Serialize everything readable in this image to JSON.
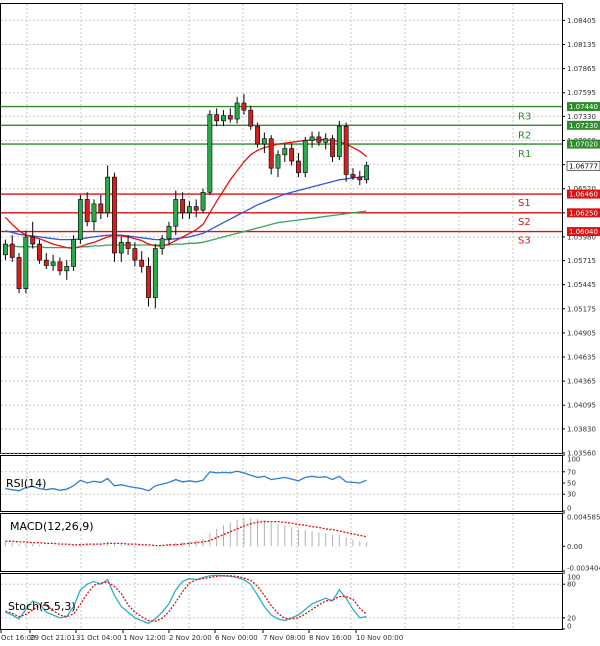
{
  "chart_data": [
    {
      "type": "candlestick",
      "panel": "main",
      "title": "",
      "ylim": [
        1.0356,
        1.086
      ],
      "y_ticks": [
        "1.08405",
        "1.08135",
        "1.07865",
        "1.07595",
        "1.07330",
        "1.07060",
        "1.06790",
        "1.06520",
        "1.06250",
        "1.05980",
        "1.05715",
        "1.05445",
        "1.05175",
        "1.04905",
        "1.04635",
        "1.04365",
        "1.04095",
        "1.03830",
        "1.03560"
      ],
      "x_ticks": [
        "Oct 16:00",
        "29 Oct 21:01",
        "31 Oct 04:00",
        "1 Nov 12:00",
        "2 Nov 20:00",
        "6 Nov 00:00",
        "7 Nov 08:00",
        "8 Nov 16:00",
        "10 Nov 00:00"
      ],
      "current_price": {
        "label": "1.06777",
        "value": 1.06777
      },
      "levels": [
        {
          "name": "R3",
          "value": 1.0744,
          "label": "1.07440",
          "color": "#2e8b2e"
        },
        {
          "name": "R2",
          "value": 1.0723,
          "label": "1.07230",
          "color": "#2e8b2e"
        },
        {
          "name": "R1",
          "value": 1.0702,
          "label": "1.07020",
          "color": "#2e8b2e"
        },
        {
          "name": "S1",
          "value": 1.0646,
          "label": "1.06460",
          "color": "#dd1111"
        },
        {
          "name": "S2",
          "value": 1.0625,
          "label": "1.06250",
          "color": "#dd1111"
        },
        {
          "name": "S3",
          "value": 1.0604,
          "label": "1.06040",
          "color": "#dd1111"
        }
      ],
      "candles": [
        [
          1.0578,
          1.0595,
          1.0572,
          1.059
        ],
        [
          1.059,
          1.06,
          1.057,
          1.0575
        ],
        [
          1.0575,
          1.058,
          1.0535,
          1.054
        ],
        [
          1.054,
          1.0605,
          1.0535,
          1.0598
        ],
        [
          1.0598,
          1.0615,
          1.0585,
          1.059
        ],
        [
          1.059,
          1.0595,
          1.0568,
          1.0572
        ],
        [
          1.0572,
          1.058,
          1.0562,
          1.0566
        ],
        [
          1.0566,
          1.0578,
          1.056,
          1.057
        ],
        [
          1.057,
          1.0575,
          1.0555,
          1.056
        ],
        [
          1.056,
          1.0572,
          1.055,
          1.0565
        ],
        [
          1.0565,
          1.06,
          1.056,
          1.0595
        ],
        [
          1.0595,
          1.0645,
          1.059,
          1.064
        ],
        [
          1.064,
          1.0648,
          1.061,
          1.0615
        ],
        [
          1.0615,
          1.064,
          1.0605,
          1.0635
        ],
        [
          1.0635,
          1.0645,
          1.0618,
          1.0625
        ],
        [
          1.0625,
          1.0678,
          1.062,
          1.0665
        ],
        [
          1.0665,
          1.067,
          1.057,
          1.058
        ],
        [
          1.058,
          1.0598,
          1.057,
          1.0592
        ],
        [
          1.0592,
          1.06,
          1.0578,
          1.0585
        ],
        [
          1.0585,
          1.0592,
          1.0565,
          1.0572
        ],
        [
          1.0572,
          1.0582,
          1.0558,
          1.0565
        ],
        [
          1.0565,
          1.0575,
          1.052,
          1.053
        ],
        [
          1.053,
          1.059,
          1.0518,
          1.0585
        ],
        [
          1.0585,
          1.06,
          1.0578,
          1.0596
        ],
        [
          1.0596,
          1.0615,
          1.059,
          1.061
        ],
        [
          1.061,
          1.065,
          1.06,
          1.064
        ],
        [
          1.064,
          1.0648,
          1.0618,
          1.0625
        ],
        [
          1.0625,
          1.0638,
          1.0618,
          1.0632
        ],
        [
          1.0632,
          1.064,
          1.062,
          1.0628
        ],
        [
          1.0628,
          1.0652,
          1.0625,
          1.0648
        ],
        [
          1.0648,
          1.074,
          1.0645,
          1.0735
        ],
        [
          1.0735,
          1.0742,
          1.0722,
          1.0728
        ],
        [
          1.0728,
          1.074,
          1.0722,
          1.0734
        ],
        [
          1.0734,
          1.0742,
          1.0726,
          1.073
        ],
        [
          1.073,
          1.0755,
          1.0725,
          1.0748
        ],
        [
          1.0748,
          1.0758,
          1.0735,
          1.074
        ],
        [
          1.074,
          1.0745,
          1.0718,
          1.0722
        ],
        [
          1.0722,
          1.0726,
          1.0698,
          1.0702
        ],
        [
          1.0702,
          1.0715,
          1.0692,
          1.0708
        ],
        [
          1.0708,
          1.0712,
          1.0668,
          1.0675
        ],
        [
          1.0675,
          1.0695,
          1.0665,
          1.069
        ],
        [
          1.069,
          1.0702,
          1.0682,
          1.0697
        ],
        [
          1.0697,
          1.0703,
          1.0678,
          1.0683
        ],
        [
          1.0683,
          1.0692,
          1.0665,
          1.067
        ],
        [
          1.067,
          1.071,
          1.0665,
          1.0706
        ],
        [
          1.0706,
          1.0716,
          1.0698,
          1.071
        ],
        [
          1.071,
          1.0716,
          1.07,
          1.0704
        ],
        [
          1.0704,
          1.0714,
          1.0696,
          1.0708
        ],
        [
          1.0708,
          1.0712,
          1.0682,
          1.0688
        ],
        [
          1.0688,
          1.0728,
          1.0684,
          1.0722
        ],
        [
          1.0722,
          1.0726,
          1.066,
          1.0668
        ],
        [
          1.0668,
          1.0675,
          1.0662,
          1.0665
        ],
        [
          1.0665,
          1.0672,
          1.0656,
          1.0662
        ],
        [
          1.0662,
          1.0682,
          1.0658,
          1.0678
        ]
      ],
      "ma_red": [
        1.062,
        1.0612,
        1.0605,
        1.06,
        1.0598,
        1.0596,
        1.0593,
        1.059,
        1.0588,
        1.0586,
        1.0585,
        1.0587,
        1.059,
        1.0592,
        1.0595,
        1.0598,
        1.06,
        1.0599,
        1.0598,
        1.0596,
        1.0594,
        1.059,
        1.0588,
        1.0588,
        1.059,
        1.0594,
        1.0598,
        1.0602,
        1.0606,
        1.0612,
        1.0625,
        1.0638,
        1.065,
        1.0662,
        1.0672,
        1.0682,
        1.069,
        1.0695,
        1.0698,
        1.07,
        1.0702,
        1.0703,
        1.0704,
        1.0705,
        1.0706,
        1.0707,
        1.0707,
        1.0707,
        1.0706,
        1.0705,
        1.0702,
        1.0698,
        1.0694,
        1.0688
      ],
      "ma_blue": [
        1.0605,
        1.0603,
        1.0601,
        1.06,
        1.0599,
        1.0598,
        1.0597,
        1.0596,
        1.0595,
        1.0595,
        1.0595,
        1.0596,
        1.0597,
        1.0598,
        1.0599,
        1.06,
        1.06,
        1.06,
        1.0599,
        1.0598,
        1.0597,
        1.0596,
        1.0595,
        1.0595,
        1.0595,
        1.0596,
        1.0597,
        1.0598,
        1.06,
        1.0602,
        1.0606,
        1.061,
        1.0614,
        1.0618,
        1.0622,
        1.0626,
        1.063,
        1.0634,
        1.0637,
        1.064,
        1.0643,
        1.0646,
        1.0648,
        1.065,
        1.0652,
        1.0654,
        1.0656,
        1.0658,
        1.066,
        1.0662,
        1.0663,
        1.0664,
        1.0665,
        1.0666
      ],
      "ma_green": [
        1.0588,
        1.0588,
        1.0587,
        1.0587,
        1.0587,
        1.0587,
        1.0586,
        1.0586,
        1.0586,
        1.0586,
        1.0586,
        1.0587,
        1.0587,
        1.0588,
        1.0588,
        1.0589,
        1.0589,
        1.0589,
        1.0589,
        1.0589,
        1.0589,
        1.0589,
        1.0589,
        1.0589,
        1.0589,
        1.059,
        1.059,
        1.0591,
        1.0591,
        1.0592,
        1.0594,
        1.0596,
        1.0598,
        1.06,
        1.0602,
        1.0604,
        1.0606,
        1.0608,
        1.061,
        1.0612,
        1.0614,
        1.0615,
        1.0616,
        1.0617,
        1.0618,
        1.0619,
        1.062,
        1.0621,
        1.0622,
        1.0623,
        1.0624,
        1.0625,
        1.0626,
        1.0627
      ]
    },
    {
      "type": "line",
      "panel": "rsi",
      "title": "RSI(14)",
      "ylim": [
        0,
        100
      ],
      "y_ticks": [
        "100",
        "70",
        "50",
        "30",
        "0"
      ],
      "values": [
        40,
        38,
        36,
        42,
        44,
        40,
        38,
        40,
        37,
        39,
        45,
        55,
        50,
        53,
        51,
        58,
        45,
        47,
        44,
        42,
        40,
        36,
        45,
        48,
        51,
        56,
        52,
        54,
        52,
        55,
        70,
        68,
        69,
        68,
        71,
        68,
        64,
        60,
        62,
        56,
        58,
        60,
        57,
        54,
        60,
        62,
        60,
        61,
        56,
        62,
        52,
        51,
        50,
        55
      ]
    },
    {
      "type": "bar",
      "panel": "macd",
      "title": "MACD(12,26,9)",
      "ylim": [
        -0.003404,
        0.004585
      ],
      "y_ticks": [
        "0.004585",
        "0.00",
        "-0.003404"
      ],
      "histogram": [
        0.0006,
        0.0005,
        0.0003,
        0.0003,
        0.0003,
        0.0002,
        0.0001,
        0.0001,
        0.0,
        0.0,
        0.0001,
        0.0003,
        0.0003,
        0.0004,
        0.0004,
        0.0006,
        0.0004,
        0.0003,
        0.0002,
        0.0001,
        0.0,
        -0.0001,
        0.0,
        0.0001,
        0.0003,
        0.0005,
        0.0006,
        0.0007,
        0.0008,
        0.001,
        0.0018,
        0.0024,
        0.0029,
        0.0033,
        0.0037,
        0.0039,
        0.0039,
        0.0038,
        0.0036,
        0.0033,
        0.0031,
        0.0029,
        0.0026,
        0.0023,
        0.0022,
        0.0021,
        0.0019,
        0.0018,
        0.0016,
        0.0016,
        0.0012,
        0.0009,
        0.0007,
        0.0006
      ],
      "signal": [
        0.0007,
        0.0007,
        0.0006,
        0.0006,
        0.0005,
        0.0005,
        0.0004,
        0.0004,
        0.0003,
        0.0003,
        0.0002,
        0.0002,
        0.0003,
        0.0003,
        0.0003,
        0.0004,
        0.0004,
        0.0004,
        0.0003,
        0.0003,
        0.0002,
        0.0002,
        0.0001,
        0.0001,
        0.0002,
        0.0002,
        0.0003,
        0.0004,
        0.0005,
        0.0006,
        0.0008,
        0.0012,
        0.0016,
        0.002,
        0.0024,
        0.0028,
        0.0031,
        0.0033,
        0.0034,
        0.0034,
        0.0034,
        0.0033,
        0.0032,
        0.003,
        0.0029,
        0.0027,
        0.0026,
        0.0024,
        0.0023,
        0.0021,
        0.0019,
        0.0017,
        0.0015,
        0.0013
      ]
    },
    {
      "type": "line",
      "panel": "stoch",
      "title": "Stoch(5,5,3)",
      "ylim": [
        0,
        100
      ],
      "y_ticks": [
        "100",
        "80",
        "20",
        "0"
      ],
      "main": [
        30,
        25,
        18,
        35,
        50,
        45,
        30,
        25,
        20,
        22,
        40,
        70,
        80,
        85,
        80,
        88,
        60,
        40,
        30,
        20,
        15,
        10,
        18,
        30,
        45,
        70,
        85,
        90,
        88,
        92,
        95,
        96,
        95,
        94,
        92,
        88,
        80,
        60,
        40,
        25,
        18,
        15,
        20,
        25,
        35,
        45,
        50,
        55,
        50,
        70,
        55,
        35,
        20,
        22
      ],
      "signal": [
        32,
        28,
        22,
        26,
        34,
        43,
        42,
        33,
        25,
        22,
        27,
        44,
        63,
        78,
        82,
        84,
        76,
        63,
        43,
        30,
        22,
        15,
        14,
        19,
        31,
        48,
        67,
        82,
        88,
        90,
        92,
        94,
        95,
        95,
        94,
        91,
        87,
        76,
        60,
        42,
        28,
        19,
        18,
        20,
        27,
        35,
        43,
        50,
        52,
        58,
        58,
        53,
        37,
        26
      ]
    }
  ]
}
